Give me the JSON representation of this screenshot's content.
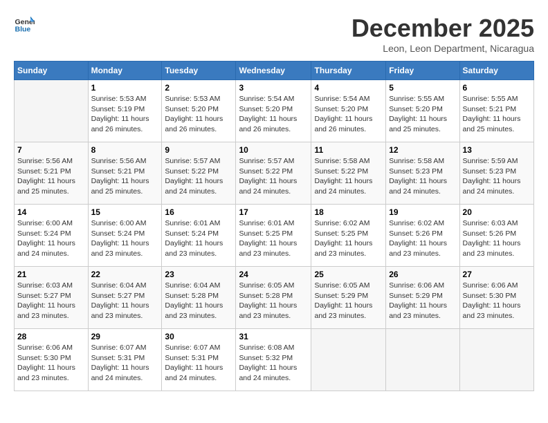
{
  "header": {
    "logo_general": "General",
    "logo_blue": "Blue",
    "month_title": "December 2025",
    "location": "Leon, Leon Department, Nicaragua"
  },
  "days_of_week": [
    "Sunday",
    "Monday",
    "Tuesday",
    "Wednesday",
    "Thursday",
    "Friday",
    "Saturday"
  ],
  "weeks": [
    [
      {
        "day": "",
        "empty": true
      },
      {
        "day": "1",
        "sunrise": "Sunrise: 5:53 AM",
        "sunset": "Sunset: 5:19 PM",
        "daylight": "Daylight: 11 hours and 26 minutes."
      },
      {
        "day": "2",
        "sunrise": "Sunrise: 5:53 AM",
        "sunset": "Sunset: 5:20 PM",
        "daylight": "Daylight: 11 hours and 26 minutes."
      },
      {
        "day": "3",
        "sunrise": "Sunrise: 5:54 AM",
        "sunset": "Sunset: 5:20 PM",
        "daylight": "Daylight: 11 hours and 26 minutes."
      },
      {
        "day": "4",
        "sunrise": "Sunrise: 5:54 AM",
        "sunset": "Sunset: 5:20 PM",
        "daylight": "Daylight: 11 hours and 26 minutes."
      },
      {
        "day": "5",
        "sunrise": "Sunrise: 5:55 AM",
        "sunset": "Sunset: 5:20 PM",
        "daylight": "Daylight: 11 hours and 25 minutes."
      },
      {
        "day": "6",
        "sunrise": "Sunrise: 5:55 AM",
        "sunset": "Sunset: 5:21 PM",
        "daylight": "Daylight: 11 hours and 25 minutes."
      }
    ],
    [
      {
        "day": "7",
        "sunrise": "Sunrise: 5:56 AM",
        "sunset": "Sunset: 5:21 PM",
        "daylight": "Daylight: 11 hours and 25 minutes."
      },
      {
        "day": "8",
        "sunrise": "Sunrise: 5:56 AM",
        "sunset": "Sunset: 5:21 PM",
        "daylight": "Daylight: 11 hours and 25 minutes."
      },
      {
        "day": "9",
        "sunrise": "Sunrise: 5:57 AM",
        "sunset": "Sunset: 5:22 PM",
        "daylight": "Daylight: 11 hours and 24 minutes."
      },
      {
        "day": "10",
        "sunrise": "Sunrise: 5:57 AM",
        "sunset": "Sunset: 5:22 PM",
        "daylight": "Daylight: 11 hours and 24 minutes."
      },
      {
        "day": "11",
        "sunrise": "Sunrise: 5:58 AM",
        "sunset": "Sunset: 5:22 PM",
        "daylight": "Daylight: 11 hours and 24 minutes."
      },
      {
        "day": "12",
        "sunrise": "Sunrise: 5:58 AM",
        "sunset": "Sunset: 5:23 PM",
        "daylight": "Daylight: 11 hours and 24 minutes."
      },
      {
        "day": "13",
        "sunrise": "Sunrise: 5:59 AM",
        "sunset": "Sunset: 5:23 PM",
        "daylight": "Daylight: 11 hours and 24 minutes."
      }
    ],
    [
      {
        "day": "14",
        "sunrise": "Sunrise: 6:00 AM",
        "sunset": "Sunset: 5:24 PM",
        "daylight": "Daylight: 11 hours and 24 minutes."
      },
      {
        "day": "15",
        "sunrise": "Sunrise: 6:00 AM",
        "sunset": "Sunset: 5:24 PM",
        "daylight": "Daylight: 11 hours and 23 minutes."
      },
      {
        "day": "16",
        "sunrise": "Sunrise: 6:01 AM",
        "sunset": "Sunset: 5:24 PM",
        "daylight": "Daylight: 11 hours and 23 minutes."
      },
      {
        "day": "17",
        "sunrise": "Sunrise: 6:01 AM",
        "sunset": "Sunset: 5:25 PM",
        "daylight": "Daylight: 11 hours and 23 minutes."
      },
      {
        "day": "18",
        "sunrise": "Sunrise: 6:02 AM",
        "sunset": "Sunset: 5:25 PM",
        "daylight": "Daylight: 11 hours and 23 minutes."
      },
      {
        "day": "19",
        "sunrise": "Sunrise: 6:02 AM",
        "sunset": "Sunset: 5:26 PM",
        "daylight": "Daylight: 11 hours and 23 minutes."
      },
      {
        "day": "20",
        "sunrise": "Sunrise: 6:03 AM",
        "sunset": "Sunset: 5:26 PM",
        "daylight": "Daylight: 11 hours and 23 minutes."
      }
    ],
    [
      {
        "day": "21",
        "sunrise": "Sunrise: 6:03 AM",
        "sunset": "Sunset: 5:27 PM",
        "daylight": "Daylight: 11 hours and 23 minutes."
      },
      {
        "day": "22",
        "sunrise": "Sunrise: 6:04 AM",
        "sunset": "Sunset: 5:27 PM",
        "daylight": "Daylight: 11 hours and 23 minutes."
      },
      {
        "day": "23",
        "sunrise": "Sunrise: 6:04 AM",
        "sunset": "Sunset: 5:28 PM",
        "daylight": "Daylight: 11 hours and 23 minutes."
      },
      {
        "day": "24",
        "sunrise": "Sunrise: 6:05 AM",
        "sunset": "Sunset: 5:28 PM",
        "daylight": "Daylight: 11 hours and 23 minutes."
      },
      {
        "day": "25",
        "sunrise": "Sunrise: 6:05 AM",
        "sunset": "Sunset: 5:29 PM",
        "daylight": "Daylight: 11 hours and 23 minutes."
      },
      {
        "day": "26",
        "sunrise": "Sunrise: 6:06 AM",
        "sunset": "Sunset: 5:29 PM",
        "daylight": "Daylight: 11 hours and 23 minutes."
      },
      {
        "day": "27",
        "sunrise": "Sunrise: 6:06 AM",
        "sunset": "Sunset: 5:30 PM",
        "daylight": "Daylight: 11 hours and 23 minutes."
      }
    ],
    [
      {
        "day": "28",
        "sunrise": "Sunrise: 6:06 AM",
        "sunset": "Sunset: 5:30 PM",
        "daylight": "Daylight: 11 hours and 23 minutes."
      },
      {
        "day": "29",
        "sunrise": "Sunrise: 6:07 AM",
        "sunset": "Sunset: 5:31 PM",
        "daylight": "Daylight: 11 hours and 24 minutes."
      },
      {
        "day": "30",
        "sunrise": "Sunrise: 6:07 AM",
        "sunset": "Sunset: 5:31 PM",
        "daylight": "Daylight: 11 hours and 24 minutes."
      },
      {
        "day": "31",
        "sunrise": "Sunrise: 6:08 AM",
        "sunset": "Sunset: 5:32 PM",
        "daylight": "Daylight: 11 hours and 24 minutes."
      },
      {
        "day": "",
        "empty": true
      },
      {
        "day": "",
        "empty": true
      },
      {
        "day": "",
        "empty": true
      }
    ]
  ]
}
